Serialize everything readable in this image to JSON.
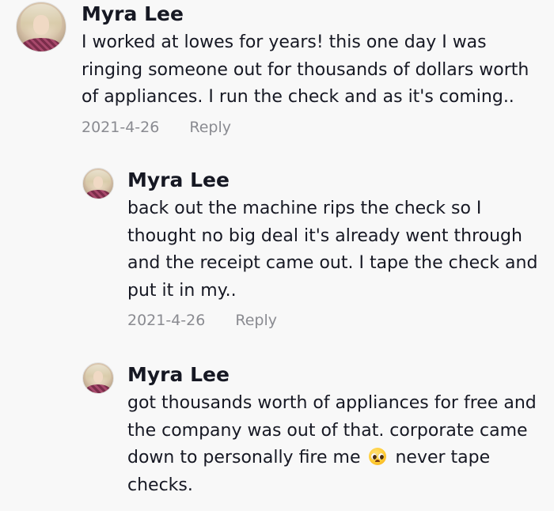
{
  "comments": [
    {
      "username": "Myra Lee",
      "text": "I worked at lowes for years! this one day I was ringing someone out for thousands of dollars worth of appliances. I run the check and as it's coming..",
      "date": "2021-4-26",
      "reply_label": "Reply"
    },
    {
      "username": "Myra Lee",
      "text": "back out the machine rips the check so I thought no big deal it's already went through and the receipt came out. I tape the check and put it in my..",
      "date": "2021-4-26",
      "reply_label": "Reply"
    },
    {
      "username": "Myra Lee",
      "text_before_emoji": "got thousands worth of appliances for free and the company was out of that. corporate came down to personally fire me",
      "emoji": "pleading-face",
      "text_after_emoji": "never tape checks."
    }
  ],
  "colors": {
    "background": "#f8f8f8",
    "text": "#161823",
    "meta": "#8a8b91"
  }
}
